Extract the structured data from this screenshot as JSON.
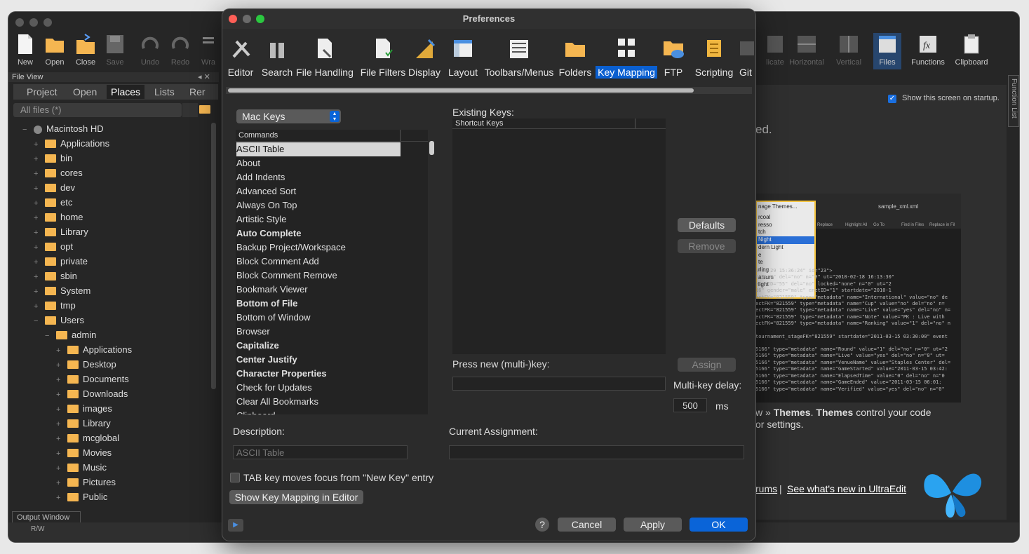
{
  "bg_app": {
    "toolbar": [
      {
        "label": "New",
        "icon": "new-file-icon"
      },
      {
        "label": "Open",
        "icon": "open-folder-icon"
      },
      {
        "label": "Close",
        "icon": "close-folder-icon"
      },
      {
        "label": "Save",
        "icon": "save-icon"
      },
      {
        "label": "Undo",
        "icon": "undo-icon"
      },
      {
        "label": "Redo",
        "icon": "redo-icon"
      },
      {
        "label": "Wra",
        "icon": "wrap-icon"
      }
    ],
    "toolbar_right": [
      {
        "label": "licate",
        "icon": "duplicate-icon"
      },
      {
        "label": "Horizontal",
        "icon": "horizontal-split-icon"
      },
      {
        "label": "Vertical",
        "icon": "vertical-split-icon"
      },
      {
        "label": "Files",
        "icon": "files-icon"
      },
      {
        "label": "Functions",
        "icon": "functions-icon"
      },
      {
        "label": "Clipboard",
        "icon": "clipboard-icon"
      }
    ],
    "file_view_title": "File View",
    "panel_tabs": [
      "Project",
      "Open",
      "Places",
      "Lists",
      "Rer"
    ],
    "filter_value": "All files (*)",
    "tree_root": "Macintosh HD",
    "tree_top": [
      "Applications",
      "bin",
      "cores",
      "dev",
      "etc",
      "home",
      "Library",
      "opt",
      "private",
      "sbin",
      "System",
      "tmp",
      "Users"
    ],
    "tree_admin": "admin",
    "tree_admin_children": [
      "Applications",
      "Desktop",
      "Documents",
      "Downloads",
      "images",
      "Library",
      "mcglobal",
      "Movies",
      "Music",
      "Pictures",
      "Public"
    ],
    "output_window": "Output Window",
    "status_rw": "R/W",
    "startup_checkbox": "Show this screen on startup.",
    "function_list_tab": "Function List",
    "welcome_partial": "ed.",
    "themes_text_1_a": "w » ",
    "themes_text_1_b": "Themes",
    "themes_text_1_c": ". ",
    "themes_text_1_d": "Themes",
    "themes_text_1_e": " control your code",
    "themes_text_2": "or settings.",
    "link_forums": "rums",
    "link_sep": "|",
    "link_whats_new": "See what's new in UltraEdit",
    "preview_menu_title": "nage Themes...",
    "preview_file": "sample_xml.xml",
    "preview_themes": [
      "rcoal",
      "resso",
      "tch",
      "Night",
      "dern Light",
      "e",
      "te",
      "rling",
      "anium",
      "light"
    ],
    "preview_tools": [
      "Replace",
      "Highlight All",
      "Go To",
      "Find in Files",
      "Replace in Fil"
    ],
    "preview_code": [
      "3-12-29 15:36:24\" id=\"23\">",
      "tID=\"0\" del=\"no\" n=\"0\" ut=\"2010-02-18 16:13:30\"",
      "asonID=\"55\" del=\"no\" locked=\"none\" n=\"0\" ut=\"2",
      "16\" gender=\"male\" enetID=\"1\" startdate=\"2010-1",
      "ectFK=\"821559\" type=\"metadata\" name=\"International\" value=\"no\" de",
      "ectFK=\"821559\" type=\"metadata\" name=\"Cup\" value=\"no\" del=\"no\" n=",
      "ectFK=\"821559\" type=\"metadata\" name=\"Live\" value=\"yes\" del=\"no\" n=",
      "ectFK=\"821559\" type=\"metadata\" name=\"Note\" value=\"PK : Live with",
      "ectFK=\"821559\" type=\"metadata\" name=\"Ranking\" value=\"1\" del=\"no\" n",
      "tournament_stageFK=\"821559\" startdate=\"2011-03-15 03:30:00\" event",
      "5166\" type=\"metadata\" name=\"Round\" value=\"1\" del=\"no\" n=\"0\" ut=\"2",
      "5166\" type=\"metadata\" name=\"Live\" value=\"yes\" del=\"no\" n=\"0\" ut=",
      "5166\" type=\"metadata\" name=\"VenueName\" value=\"Staples Center\" del=",
      "5166\" type=\"metadata\" name=\"GameStarted\" value=\"2011-03-15 03:42:",
      "5166\" type=\"metadata\" name=\"ElapsedTime\" value=\"0\" del=\"no\" n=\"0",
      "5166\" type=\"metadata\" name=\"GameEnded\" value=\"2011-03-15 06:01:",
      "5166\" type=\"metadata\" name=\"Verified\" value=\"yes\" del=\"no\" n=\"0\""
    ]
  },
  "dialog": {
    "title": "Preferences",
    "tabs": [
      {
        "label": "Editor",
        "icon": "editor-tools-icon"
      },
      {
        "label": "Search",
        "icon": "binoculars-icon"
      },
      {
        "label": "File Handling",
        "icon": "file-handling-icon"
      },
      {
        "label": "File Filters",
        "icon": "file-filters-icon"
      },
      {
        "label": "Display",
        "icon": "display-ruler-icon"
      },
      {
        "label": "Layout",
        "icon": "layout-icon"
      },
      {
        "label": "Toolbars/Menus",
        "icon": "toolbars-menus-icon"
      },
      {
        "label": "Folders",
        "icon": "folder-icon"
      },
      {
        "label": "Key Mapping",
        "icon": "key-mapping-icon"
      },
      {
        "label": "FTP",
        "icon": "ftp-cloud-icon"
      },
      {
        "label": "Scripting",
        "icon": "scripting-scroll-icon"
      },
      {
        "label": "Git",
        "icon": "git-icon"
      }
    ],
    "selected_tab": "Key Mapping",
    "keyset_select": "Mac Keys",
    "commands_header": "Commands",
    "commands": [
      {
        "label": "ASCII Table",
        "bold": false
      },
      {
        "label": "About",
        "bold": false
      },
      {
        "label": "Add Indents",
        "bold": false
      },
      {
        "label": "Advanced Sort",
        "bold": false
      },
      {
        "label": "Always On Top",
        "bold": false
      },
      {
        "label": "Artistic Style",
        "bold": false
      },
      {
        "label": "Auto Complete",
        "bold": true
      },
      {
        "label": "Backup Project/Workspace",
        "bold": false
      },
      {
        "label": "Block Comment Add",
        "bold": false
      },
      {
        "label": "Block Comment Remove",
        "bold": false
      },
      {
        "label": "Bookmark Viewer",
        "bold": false
      },
      {
        "label": "Bottom of File",
        "bold": true
      },
      {
        "label": "Bottom of Window",
        "bold": false
      },
      {
        "label": "Browser",
        "bold": false
      },
      {
        "label": "Capitalize",
        "bold": true
      },
      {
        "label": "Center Justify",
        "bold": true
      },
      {
        "label": "Character Properties",
        "bold": true
      },
      {
        "label": "Check for Updates",
        "bold": false
      },
      {
        "label": "Clear All Bookmarks",
        "bold": false
      },
      {
        "label": "Clipboard",
        "bold": false
      }
    ],
    "existing_keys_label": "Existing Keys:",
    "shortcut_keys_header": "Shortcut Keys",
    "defaults_button": "Defaults",
    "remove_button": "Remove",
    "press_new_key_label": "Press new (multi-)key:",
    "assign_button": "Assign",
    "multikey_delay_label": "Multi-key delay:",
    "multikey_delay_value": "500",
    "ms_label": "ms",
    "description_label": "Description:",
    "description_value": "ASCII Table",
    "current_assignment_label": "Current Assignment:",
    "tab_focus_checkbox": "TAB key moves focus from \"New Key\" entry",
    "show_mapping_button": "Show Key Mapping in Editor",
    "help_button": "?",
    "cancel_button": "Cancel",
    "apply_button": "Apply",
    "ok_button": "OK"
  }
}
